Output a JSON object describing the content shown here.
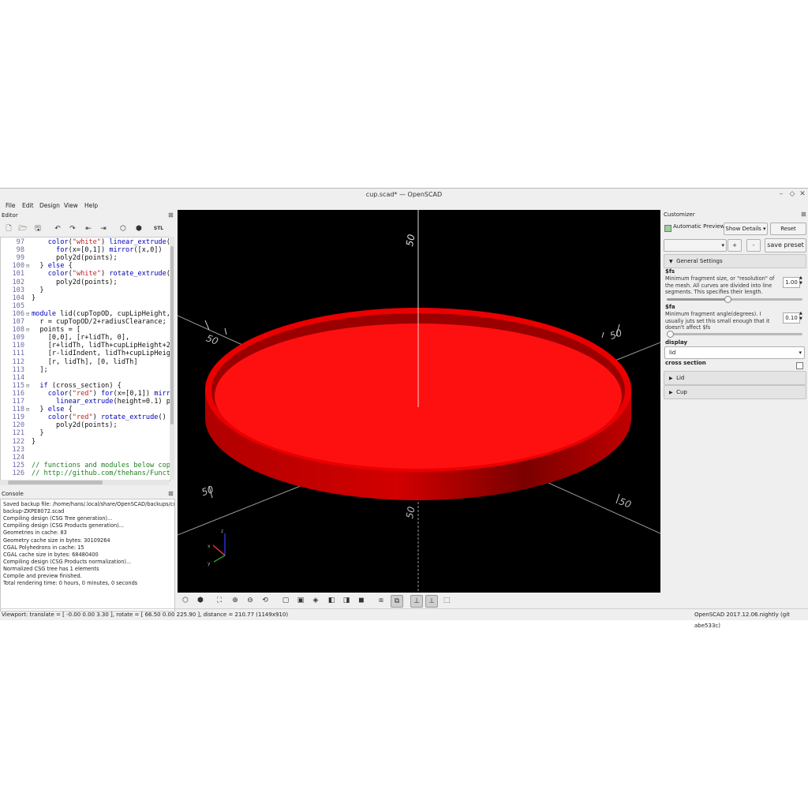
{
  "window": {
    "title": "cup.scad* — OpenSCAD",
    "controls": [
      "–",
      "◇",
      "✕"
    ]
  },
  "menu": [
    "File",
    "Edit",
    "Design",
    "View",
    "Help"
  ],
  "editor": {
    "title": "Editor",
    "toolbar_icons": [
      "new-file-icon",
      "open-file-icon",
      "save-file-icon",
      "undo-icon",
      "redo-icon",
      "unindent-icon",
      "indent-icon",
      "preview-icon",
      "render-icon",
      "export-stl-icon"
    ],
    "stl_label": "STL",
    "lines": [
      {
        "n": "97",
        "fold": "",
        "html": "    <span class='kw'>color</span>(<span class='str'>\"white\"</span>) <span class='kw'>linear_extrude</span>("
      },
      {
        "n": "98",
        "fold": "",
        "html": "      <span class='kw'>for</span>(x=[0,1]) <span class='kw'>mirror</span>([x,0])"
      },
      {
        "n": "99",
        "fold": "",
        "html": "      poly2d(points);"
      },
      {
        "n": "100",
        "fold": "⊟",
        "html": "  } <span class='kw'>else</span> {"
      },
      {
        "n": "101",
        "fold": "",
        "html": "    <span class='kw'>color</span>(<span class='str'>\"white\"</span>) <span class='kw'>rotate_extrude</span>("
      },
      {
        "n": "102",
        "fold": "",
        "html": "      poly2d(points);"
      },
      {
        "n": "103",
        "fold": "",
        "html": "  }"
      },
      {
        "n": "104",
        "fold": "",
        "html": "}"
      },
      {
        "n": "105",
        "fold": "",
        "html": ""
      },
      {
        "n": "106",
        "fold": "⊟",
        "html": "<span class='kw'>module</span> lid(cupTopOD, cupLipHeight,"
      },
      {
        "n": "107",
        "fold": "",
        "html": "  r = cupTopOD/2+radiusClearance;"
      },
      {
        "n": "108",
        "fold": "⊟",
        "html": "  points = ["
      },
      {
        "n": "109",
        "fold": "",
        "html": "    [0,0], [r+lidTh, 0],"
      },
      {
        "n": "110",
        "fold": "",
        "html": "    [r+lidTh, lidTh+cupLipHeight+2"
      },
      {
        "n": "111",
        "fold": "",
        "html": "    [r-lidIndent, lidTh+cupLipHeig"
      },
      {
        "n": "112",
        "fold": "",
        "html": "    [r, lidTh], [0, lidTh]"
      },
      {
        "n": "113",
        "fold": "",
        "html": "  ];"
      },
      {
        "n": "114",
        "fold": "",
        "html": ""
      },
      {
        "n": "115",
        "fold": "⊟",
        "html": "  <span class='kw'>if</span> (cross_section) {"
      },
      {
        "n": "116",
        "fold": "",
        "html": "    <span class='kw'>color</span>(<span class='str'>\"red\"</span>) <span class='kw'>for</span>(x=[0,1]) <span class='kw'>mirr</span>"
      },
      {
        "n": "117",
        "fold": "",
        "html": "      <span class='kw'>linear_extrude</span>(height=0.1) p"
      },
      {
        "n": "118",
        "fold": "⊟",
        "html": "  } <span class='kw'>else</span> {"
      },
      {
        "n": "119",
        "fold": "",
        "html": "    <span class='kw'>color</span>(<span class='str'>\"red\"</span>) <span class='kw'>rotate_extrude</span>()"
      },
      {
        "n": "120",
        "fold": "",
        "html": "      poly2d(points);"
      },
      {
        "n": "121",
        "fold": "",
        "html": "  }"
      },
      {
        "n": "122",
        "fold": "",
        "html": "}"
      },
      {
        "n": "123",
        "fold": "",
        "html": ""
      },
      {
        "n": "124",
        "fold": "",
        "html": ""
      },
      {
        "n": "125",
        "fold": "",
        "html": "<span class='cm'>// functions and modules below cop</span>"
      },
      {
        "n": "126",
        "fold": "",
        "html": "<span class='cm'>// http://github.com/thehans/Funct</span>"
      }
    ]
  },
  "console": {
    "title": "Console",
    "lines": [
      "Saved backup file: /home/hans/.local/share/OpenSCAD/backups/cup-",
      "backup-ZKPE8072.scad",
      "Compiling design (CSG Tree generation)...",
      "Compiling design (CSG Products generation)...",
      "Geometries in cache: 83",
      "Geometry cache size in bytes: 30109264",
      "CGAL Polyhedrons in cache: 15",
      "CGAL cache size in bytes: 68480400",
      "Compiling design (CSG Products normalization)...",
      "Normalized CSG tree has 1 elements",
      "Compile and preview finished.",
      "Total rendering time: 0 hours, 0 minutes, 0 seconds"
    ]
  },
  "viewport": {
    "axis_labels": [
      "50",
      "50",
      "50",
      "50",
      "50",
      "50",
      "50"
    ],
    "gizmo": [
      "x",
      "y",
      "z"
    ],
    "object_color": "#ff0000"
  },
  "view_toolbar": [
    "preview-icon",
    "render-icon",
    "zoom-all-icon",
    "zoom-in-icon",
    "zoom-out-icon",
    "reset-view-icon",
    "view-right-icon",
    "view-top-icon",
    "view-bottom-icon",
    "view-left-icon",
    "view-front-icon",
    "view-back-icon",
    "perspective-icon",
    "orthogonal-icon",
    "show-axes-icon",
    "show-scale-icon",
    "show-edges-icon"
  ],
  "customizer": {
    "title": "Customizer",
    "auto_preview": "Automatic Preview",
    "show_details": "Show Details",
    "reset": "Reset",
    "plus": "+",
    "minus": "-",
    "save_preset": "save preset",
    "general": "General Settings",
    "fs": {
      "label": "$fs",
      "desc": "Minimum fragment size, or \"resolution\" of the mesh.  All curves are divided into line segments. This specifies their length.",
      "value": "1.00",
      "level": 0.45
    },
    "fa": {
      "label": "$fa",
      "desc": "Minimum fragment angle(degrees).  I usually juts set this small enough that it doesn't affect $fs",
      "value": "0.10",
      "level": 0.0
    },
    "display": {
      "label": "display",
      "value": "lid"
    },
    "cross_section": {
      "label": "cross section"
    },
    "groups": [
      "Lid",
      "Cup"
    ]
  },
  "status": {
    "left": "Viewport: translate = [ -0.00 0.00 3.30 ], rotate = [ 66.50 0.00 225.90 ], distance = 210.77 (1149x910)",
    "right": "OpenSCAD 2017.12.06.nightly (git abe533c)"
  }
}
